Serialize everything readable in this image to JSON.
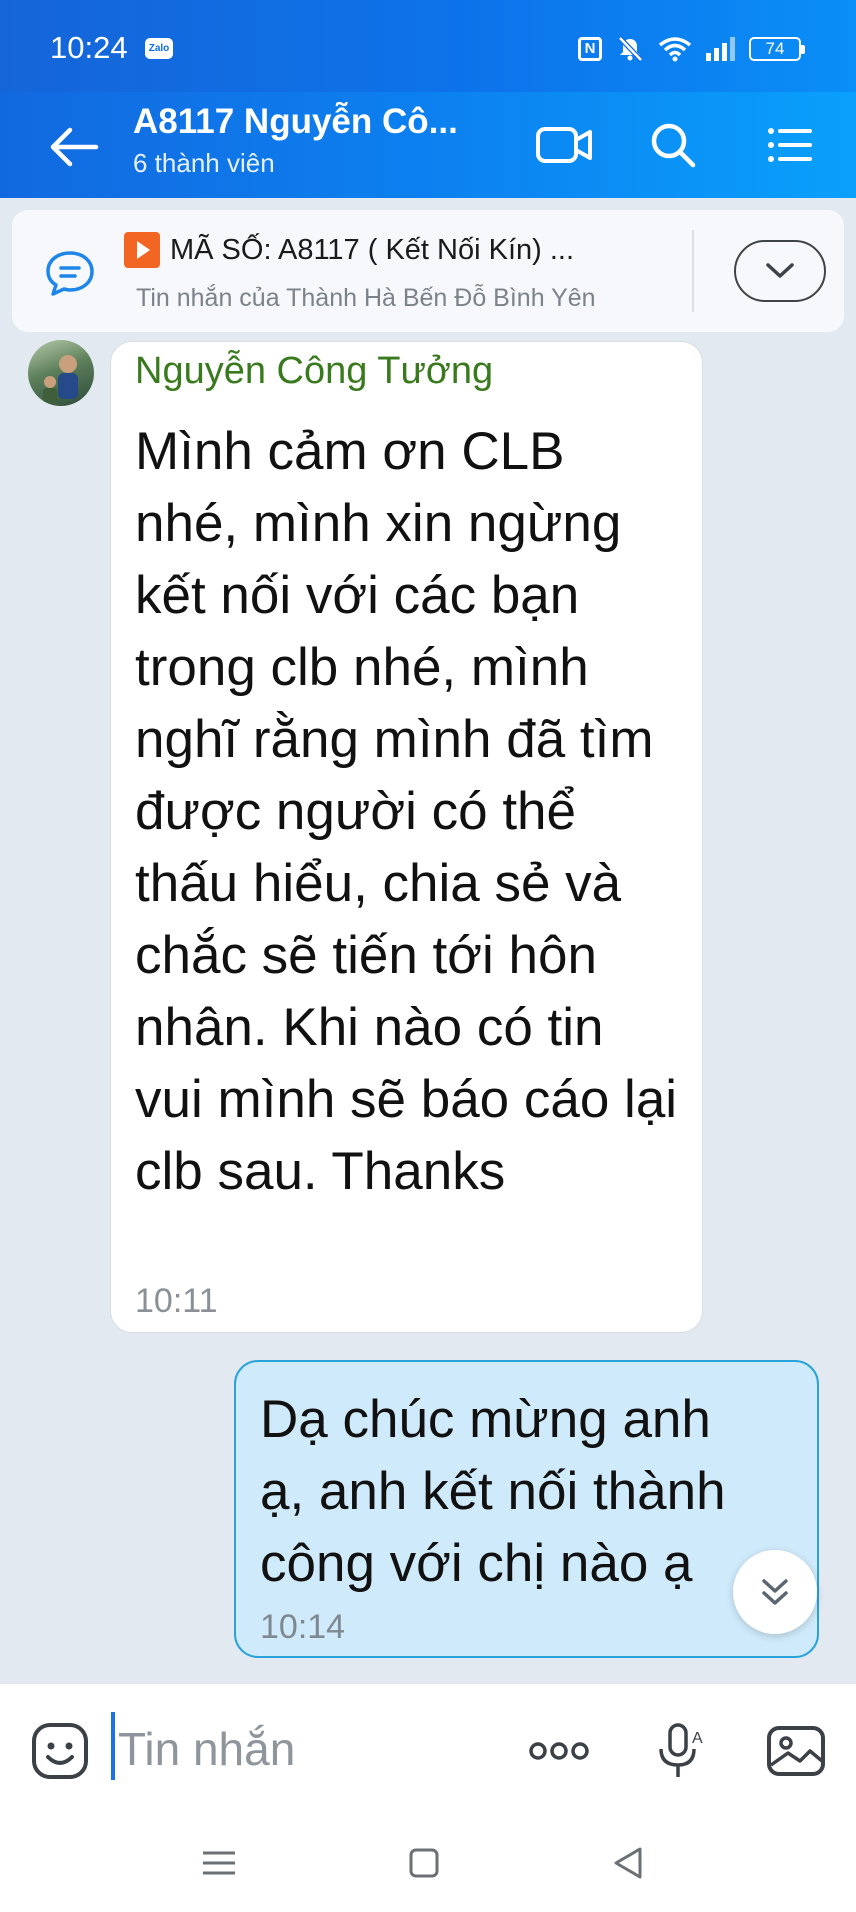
{
  "status_bar": {
    "time": "10:24",
    "app_badge": "Zalo",
    "battery": "74",
    "icons": [
      "nfc-icon",
      "mute-icon",
      "wifi-icon",
      "signal-icon",
      "battery-icon"
    ]
  },
  "header": {
    "title": "A8117 Nguyễn Cô...",
    "subtitle": "6 thành viên",
    "icons": [
      "back-arrow-icon",
      "video-call-icon",
      "search-icon",
      "menu-list-icon"
    ]
  },
  "pinned": {
    "title": "MÃ SỐ: A8117 ( Kết Nối Kín) ...",
    "subtitle": "Tin nhắn của Thành Hà Bến Đỗ Bình Yên",
    "icons": [
      "chat-bubble-icon",
      "play-icon",
      "chevron-down-icon"
    ]
  },
  "messages": [
    {
      "sender": "Nguyễn Công Tưởng",
      "text": "Mình cảm ơn CLB nhé, mình xin ngừng kết nối với các bạn trong clb nhé, mình nghĩ rằng mình đã tìm được người có thể thấu hiểu, chia sẻ và chắc sẽ tiến tới hôn nhân. Khi nào có tin vui mình sẽ báo cáo lại clb sau. Thanks",
      "time": "10:11"
    },
    {
      "text": "Dạ chúc mừng anh\nạ, anh kết nối thành\ncông với chị nào ạ",
      "time": "10:14"
    }
  ],
  "composer": {
    "placeholder": "Tin nhắn",
    "icons": [
      "emoji-icon",
      "more-options-icon",
      "voice-icon",
      "image-icon"
    ]
  },
  "nav_bar": {
    "icons": [
      "recent-apps-icon",
      "home-icon",
      "back-icon"
    ]
  },
  "colors": {
    "header_blue": "#0c80f0",
    "sender_name": "#3a7a1e",
    "outgoing_bubble": "#cfeafb",
    "outgoing_border": "#29a3d9",
    "background": "#e2e9f1"
  }
}
